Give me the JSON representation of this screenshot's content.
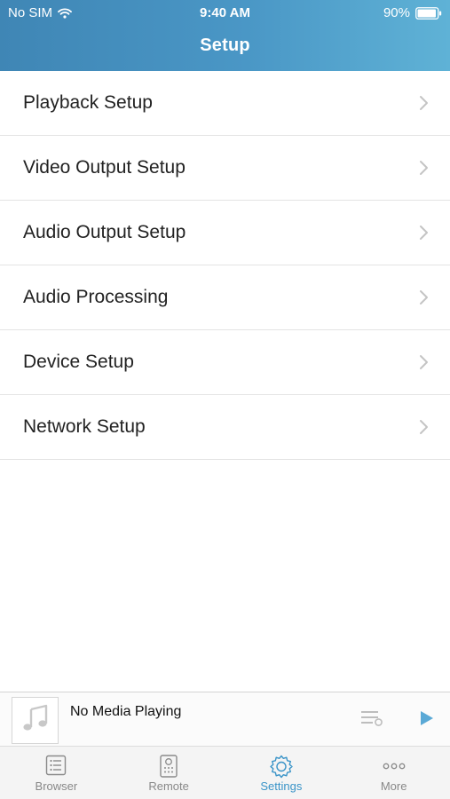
{
  "status_bar": {
    "carrier": "No SIM",
    "time": "9:40 AM",
    "battery": "90%"
  },
  "header": {
    "title": "Setup"
  },
  "menu": {
    "items": [
      {
        "label": "Playback Setup"
      },
      {
        "label": "Video Output Setup"
      },
      {
        "label": "Audio Output Setup"
      },
      {
        "label": "Audio Processing"
      },
      {
        "label": "Device Setup"
      },
      {
        "label": "Network Setup"
      }
    ]
  },
  "now_playing": {
    "text": "No Media Playing"
  },
  "tabs": [
    {
      "label": "Browser",
      "icon": "list-icon",
      "active": false
    },
    {
      "label": "Remote",
      "icon": "remote-icon",
      "active": false
    },
    {
      "label": "Settings",
      "icon": "gear-icon",
      "active": true
    },
    {
      "label": "More",
      "icon": "more-icon",
      "active": false
    }
  ],
  "colors": {
    "header_start": "#3f86b5",
    "header_end": "#5fb2d6",
    "accent": "#3a94c8",
    "tab_inactive": "#888888"
  }
}
